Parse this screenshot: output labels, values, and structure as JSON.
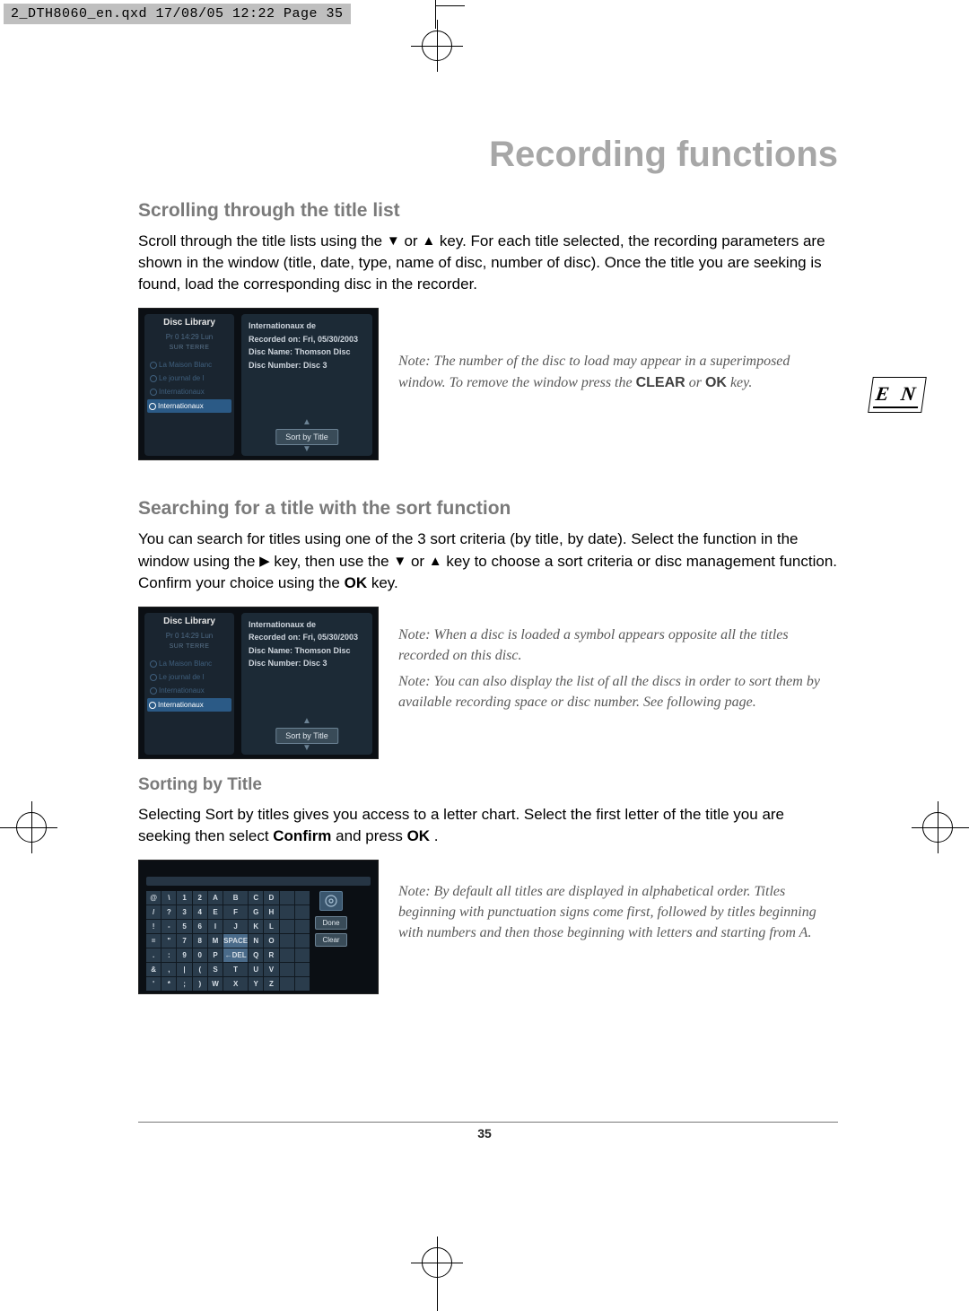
{
  "print": {
    "header": "2_DTH8060_en.qxd  17/08/05  12:22  Page 35"
  },
  "page": {
    "title": "Recording functions",
    "number": "35",
    "lang_tab": "E N"
  },
  "section1": {
    "heading": "Scrolling through the title list",
    "body_pre": "Scroll through the title lists using the ",
    "body_mid": " or ",
    "body_post": " key. For each title selected, the recording parameters are shown in the window (title, date, type, name of disc, number of disc). Once the title you are seeking is found, load the corresponding disc in the recorder.",
    "note_pre": "Note: The number of the disc to load may appear in a superimposed window. To remove the window press the ",
    "note_clear": "CLEAR",
    "note_or": " or ",
    "note_ok": "OK",
    "note_post": " key."
  },
  "section2": {
    "heading": "Searching for a title with the sort function",
    "body_pre": "You can search for titles using one of the 3 sort criteria (by title, by date). Select the function in the window using the ",
    "body_mid1": " key, then use the ",
    "body_mid2": " or ",
    "body_mid3": " key to choose a sort criteria or disc management function. Confirm your choice using the ",
    "body_ok": "OK",
    "body_post": " key.",
    "note1": "Note: When a disc is loaded a symbol appears opposite all the titles recorded on this disc.",
    "note2": "Note: You can also display the list of all the discs in order to sort them by available recording space or disc number. See following page."
  },
  "section3": {
    "heading": "Sorting by Title",
    "body_pre": "Selecting Sort by titles gives you access to a letter chart. Select the first letter of the title you are seeking then select ",
    "body_confirm": "Confirm",
    "body_mid": " and press ",
    "body_ok": "OK",
    "body_post": ".",
    "note": "Note: By default all titles are displayed in alphabetical order. Titles beginning with punctuation signs come first, followed by titles beginning with numbers and then those beginning with letters and starting from A."
  },
  "ui": {
    "library_title": "Disc Library",
    "sub1": "Pr 0  14:29 Lun",
    "sub2": "SUR TERRE",
    "items": [
      "La Maison Blanc",
      "Le journal de l",
      "Internationaux",
      "Internationaux"
    ],
    "info": {
      "l1": "Internationaux de",
      "l2": "Recorded on: Fri, 05/30/2003",
      "l3": "Disc Name: Thomson Disc",
      "l4": "Disc Number: Disc 3"
    },
    "sort_button": "Sort by Title",
    "chart": {
      "rows": [
        [
          "@",
          "\\",
          "1",
          "2",
          "A",
          "B",
          "C",
          "D"
        ],
        [
          "/",
          "?",
          "3",
          "4",
          "E",
          "F",
          "G",
          "H"
        ],
        [
          "!",
          "-",
          "5",
          "6",
          "I",
          "J",
          "K",
          "L"
        ],
        [
          "=",
          "\"",
          "7",
          "8",
          "M",
          "SPACE",
          "N",
          "O"
        ],
        [
          ".",
          ":",
          "9",
          "0",
          "P",
          "←DEL",
          "Q",
          "R"
        ],
        [
          "&",
          ",",
          "|",
          "(",
          "S",
          "T",
          "U",
          "V"
        ],
        [
          "'",
          "*",
          ";",
          ")",
          "W",
          "X",
          "Y",
          "Z"
        ]
      ],
      "btn_done": "Done",
      "btn_clear": "Clear"
    }
  }
}
